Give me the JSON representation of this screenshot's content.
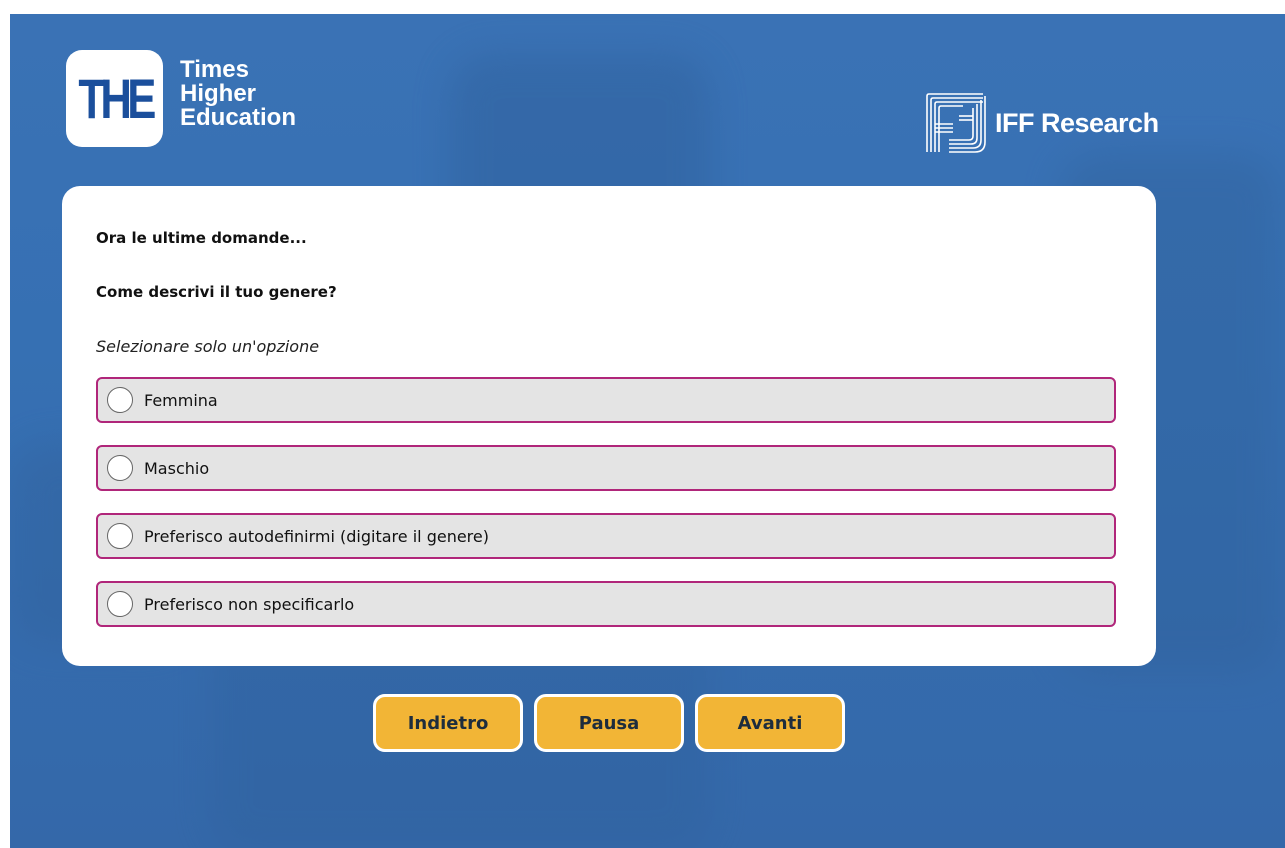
{
  "header": {
    "left_logo": {
      "mark": "THE",
      "wordmark": [
        "Times",
        "Higher",
        "Education"
      ]
    },
    "right_logo": {
      "icon": "iff-research-logo-icon",
      "text": "IFF Research"
    }
  },
  "survey": {
    "intro": "Ora le ultime domande...",
    "question": "Come descrivi il tuo genere?",
    "instruction": "Selezionare solo un'opzione",
    "options": [
      {
        "label": "Femmina",
        "selected": false
      },
      {
        "label": "Maschio",
        "selected": false
      },
      {
        "label": "Preferisco autodefinirmi (digitare il genere)",
        "selected": false
      },
      {
        "label": "Preferisco non specificarlo",
        "selected": false
      }
    ]
  },
  "navigation": {
    "back": "Indietro",
    "pause": "Pausa",
    "next": "Avanti"
  },
  "colors": {
    "background": "#3670b3",
    "option_border": "#b0267a",
    "option_fill": "#e4e4e4",
    "button_fill": "#f2b536"
  }
}
